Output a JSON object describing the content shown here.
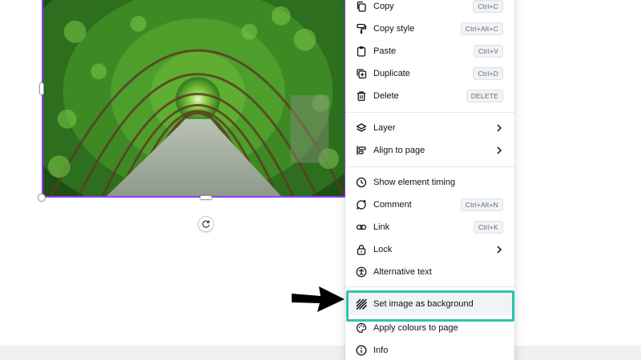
{
  "canvas": {
    "selection_color": "#8b3dff",
    "image_description_icon": "tunnel-photo"
  },
  "menu": {
    "items": [
      {
        "id": "copy",
        "label": "Copy",
        "shortcut": "Ctrl+C",
        "icon": "copy-icon"
      },
      {
        "id": "copy-style",
        "label": "Copy style",
        "shortcut": "Ctrl+Alt+C",
        "icon": "paint-roller-icon"
      },
      {
        "id": "paste",
        "label": "Paste",
        "shortcut": "Ctrl+V",
        "icon": "clipboard-icon"
      },
      {
        "id": "duplicate",
        "label": "Duplicate",
        "shortcut": "Ctrl+D",
        "icon": "duplicate-icon"
      },
      {
        "id": "delete",
        "label": "Delete",
        "shortcut": "DELETE",
        "icon": "trash-icon"
      },
      {
        "id": "layer",
        "label": "Layer",
        "icon": "layers-icon",
        "submenu": true
      },
      {
        "id": "align",
        "label": "Align to page",
        "icon": "align-icon",
        "submenu": true
      },
      {
        "id": "timing",
        "label": "Show element timing",
        "icon": "clock-icon"
      },
      {
        "id": "comment",
        "label": "Comment",
        "shortcut": "Ctrl+Alt+N",
        "icon": "comment-icon"
      },
      {
        "id": "link",
        "label": "Link",
        "shortcut": "Ctrl+K",
        "icon": "link-icon"
      },
      {
        "id": "lock",
        "label": "Lock",
        "icon": "lock-icon",
        "submenu": true
      },
      {
        "id": "alt-text",
        "label": "Alternative text",
        "icon": "accessibility-icon"
      },
      {
        "id": "set-bg",
        "label": "Set image as background",
        "icon": "hatch-icon",
        "highlighted": true
      },
      {
        "id": "apply-colours",
        "label": "Apply colours to page",
        "icon": "palette-icon"
      },
      {
        "id": "info",
        "label": "Info",
        "icon": "info-icon"
      }
    ],
    "highlight_color": "#2ec4a9"
  }
}
